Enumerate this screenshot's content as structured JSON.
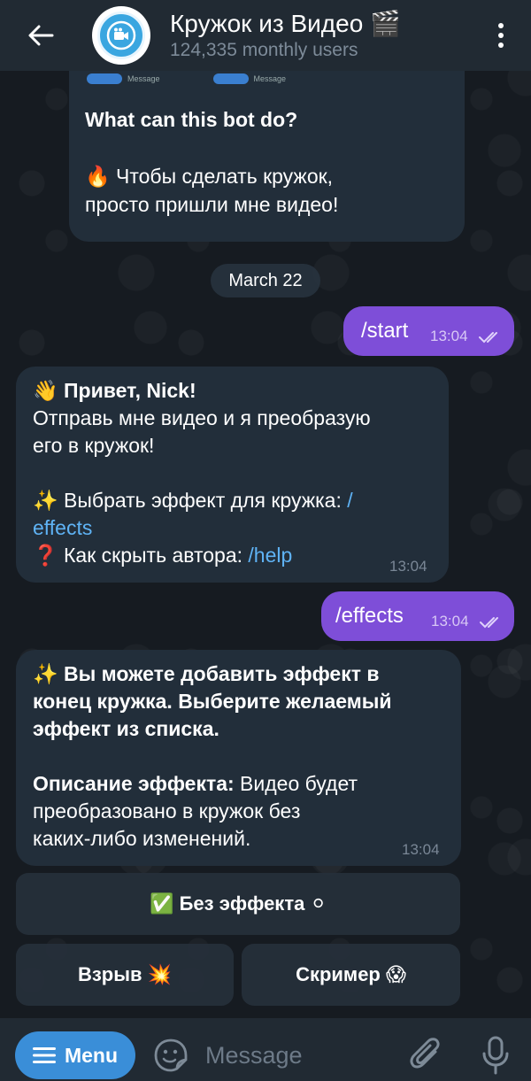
{
  "header": {
    "title": "Кружок из Видео 🎬",
    "subtitle": "124,335 monthly users"
  },
  "intro": {
    "preview_menu": "Menu",
    "preview_message": "Message",
    "title": "What can this bot do?",
    "line1": "🔥 Чтобы сделать кружок,",
    "line2": "просто пришли мне видео!"
  },
  "date_chip": "March 22",
  "messages": {
    "start": {
      "text": "/start",
      "time": "13:04"
    },
    "welcome": {
      "greeting": "👋 Привет, Nick!",
      "line1": "Отправь мне видео и я преобразую",
      "line2": "его в кружок!",
      "effects_label": "✨ Выбрать эффект для кружка: ",
      "effects_link_1": "/",
      "effects_link_2": "effects",
      "help_label": "❓ Как скрыть автора: ",
      "help_link": "/help",
      "time": "13:04"
    },
    "effects": {
      "text": "/effects",
      "time": "13:04"
    },
    "effects_reply": {
      "line1": "✨ Вы можете добавить эффект в",
      "line2": "конец кружка. Выберите желаемый",
      "line3": "эффект из списка.",
      "desc_label": "Описание эффекта:",
      "desc_rest": " Видео будет",
      "desc_line2": "преобразовано в кружок без",
      "desc_line3": "каких-либо изменений.",
      "time": "13:04"
    }
  },
  "keyboard": {
    "no_effect": "✅ Без эффекта ⚪",
    "explosion": "Взрыв 💥",
    "screamer": "Скример 😱"
  },
  "bottom": {
    "menu_label": "Menu",
    "message_placeholder": "Message"
  },
  "colors": {
    "header_bg": "#212a33",
    "incoming_bubble": "#222e3a",
    "outgoing_bubble": "#7e4ed8",
    "link": "#5fb3f5",
    "menu_button": "#3a8ed8"
  }
}
